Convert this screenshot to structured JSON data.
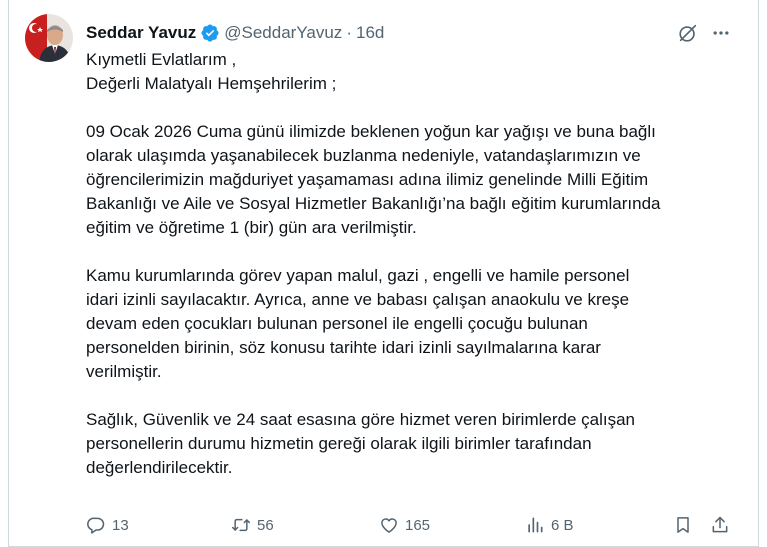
{
  "post": {
    "author_name": "Seddar Yavuz",
    "handle": "@SeddarYavuz",
    "separator": "·",
    "time": "16d",
    "lines": [
      "Kıymetli Evlatlarım ,",
      "Değerli Malatyalı Hemşehrilerim ;",
      "",
      "09 Ocak 2026 Cuma günü ilimizde beklenen yoğun kar yağışı ve buna bağlı",
      "olarak ulaşımda yaşanabilecek buzlanma nedeniyle, vatandaşlarımızın ve",
      "öğrencilerimizin mağduriyet yaşamaması adına ilimiz genelinde Milli Eğitim",
      "Bakanlığı ve Aile ve Sosyal Hizmetler Bakanlığı’na bağlı eğitim kurumlarında",
      "eğitim ve öğretime 1 (bir) gün ara verilmiştir.",
      "",
      "Kamu kurumlarında görev yapan malul, gazi , engelli ve hamile personel",
      "idari izinli sayılacaktır. Ayrıca, anne ve babası çalışan anaokulu ve kreşe",
      "devam eden çocukları bulunan personel ile engelli çocuğu bulunan",
      "personelden birinin, söz konusu tarihte idari izinli sayılmalarına karar",
      "verilmiştir.",
      "",
      "Sağlık, Güvenlik ve 24 saat esasına göre hizmet veren birimlerde çalışan",
      "personellerin durumu hizmetin gereği olarak ilgili birimler tarafından",
      "değerlendirilecektir."
    ]
  },
  "actions": {
    "replies": "13",
    "reposts": "56",
    "likes": "165",
    "views": "6 B"
  },
  "icons": {
    "verified": "verified-badge-icon",
    "grok": "grok-icon",
    "more": "more-icon",
    "reply": "reply-icon",
    "repost": "repost-icon",
    "like": "like-icon",
    "views": "views-icon",
    "bookmark": "bookmark-icon",
    "share": "share-icon"
  },
  "colors": {
    "text": "#0f1419",
    "secondary": "#536471",
    "verified": "#1d9bf0",
    "border": "#cfd9de"
  }
}
